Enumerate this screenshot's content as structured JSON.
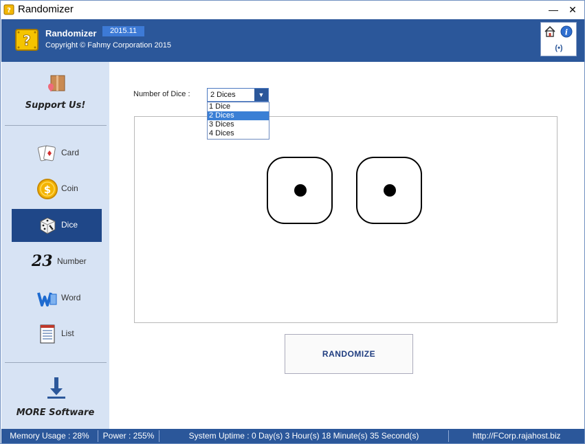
{
  "window": {
    "title": "Randomizer",
    "minimize": "—",
    "close": "✕"
  },
  "header": {
    "app_name": "Randomizer",
    "version": "2015.11",
    "copyright": "Copyright © Fahmy Corporation 2015",
    "signal_label": "(•)"
  },
  "sidebar": {
    "support_label": "Support Us!",
    "items": [
      {
        "label": "Card",
        "icon": "cards-icon"
      },
      {
        "label": "Coin",
        "icon": "coin-icon"
      },
      {
        "label": "Dice",
        "icon": "dice-icon",
        "active": true
      },
      {
        "label": "Number",
        "icon": "number-icon"
      },
      {
        "label": "Word",
        "icon": "word-icon"
      },
      {
        "label": "List",
        "icon": "list-icon"
      }
    ],
    "number_glyph": "23",
    "more_label": "MORE Software"
  },
  "main": {
    "dice_label": "Number of Dice :",
    "dice_selected": "2 Dices",
    "dice_options": [
      "1 Dice",
      "2 Dices",
      "3 Dices",
      "4 Dices"
    ],
    "dice_values": [
      1,
      1
    ],
    "randomize_label": "RANDOMIZE"
  },
  "status": {
    "memory": "Memory Usage : 28%",
    "power": "Power : 255%",
    "uptime": "System Uptime : 0 Day(s) 3 Hour(s) 18 Minute(s) 35 Second(s)",
    "url": "http://FCorp.rajahost.biz"
  },
  "colors": {
    "accent": "#2b579a",
    "sidebar": "#d7e3f4",
    "active": "#1f4788"
  }
}
